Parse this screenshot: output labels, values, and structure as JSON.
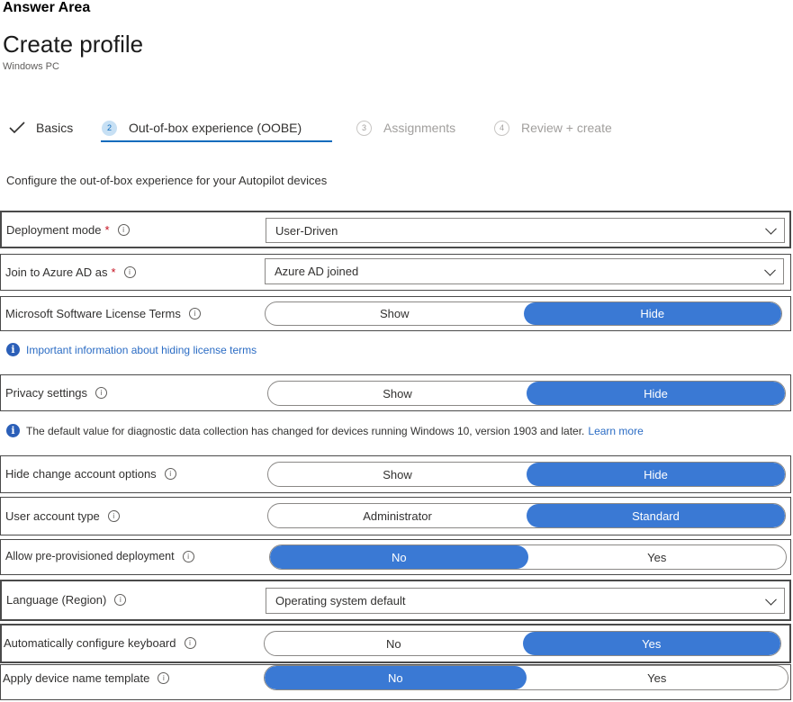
{
  "header": {
    "answer_area": "Answer Area",
    "title": "Create profile",
    "subtitle": "Windows PC"
  },
  "steps": [
    {
      "num": "",
      "label": "Basics",
      "state": "done"
    },
    {
      "num": "2",
      "label": "Out-of-box experience (OOBE)",
      "state": "active"
    },
    {
      "num": "3",
      "label": "Assignments",
      "state": "inactive"
    },
    {
      "num": "4",
      "label": "Review + create",
      "state": "inactive"
    }
  ],
  "description": "Configure the out-of-box experience for your Autopilot devices",
  "fields": {
    "deployment_mode": {
      "label": "Deployment mode",
      "required": "*",
      "value": "User-Driven"
    },
    "join_azure": {
      "label": "Join to Azure AD as",
      "required": "*",
      "value": "Azure AD joined"
    },
    "license_terms": {
      "label": "Microsoft Software License Terms",
      "options": [
        "Show",
        "Hide"
      ],
      "selected": "Hide"
    },
    "license_note": "Important information about hiding license terms",
    "privacy": {
      "label": "Privacy settings",
      "options": [
        "Show",
        "Hide"
      ],
      "selected": "Hide"
    },
    "privacy_note": "The default value for diagnostic data collection has changed for devices running Windows 10, version 1903 and later.",
    "privacy_note_link": "Learn more",
    "hide_change_account": {
      "label": "Hide change account options",
      "options": [
        "Show",
        "Hide"
      ],
      "selected": "Hide"
    },
    "user_account_type": {
      "label": "User account type",
      "options": [
        "Administrator",
        "Standard"
      ],
      "selected": "Standard"
    },
    "pre_provisioned": {
      "label": "Allow pre-provisioned deployment",
      "options": [
        "No",
        "Yes"
      ],
      "selected": "No"
    },
    "language": {
      "label": "Language (Region)",
      "value": "Operating system default"
    },
    "auto_keyboard": {
      "label": "Automatically configure keyboard",
      "options": [
        "No",
        "Yes"
      ],
      "selected": "Yes"
    },
    "device_name_template": {
      "label": "Apply device name template",
      "options": [
        "No",
        "Yes"
      ],
      "selected": "No"
    }
  },
  "icons": {
    "info": "i",
    "note": "i"
  },
  "colors": {
    "accent": "#3a79d4",
    "link": "#2b6cc4",
    "required": "#c50f1f"
  }
}
